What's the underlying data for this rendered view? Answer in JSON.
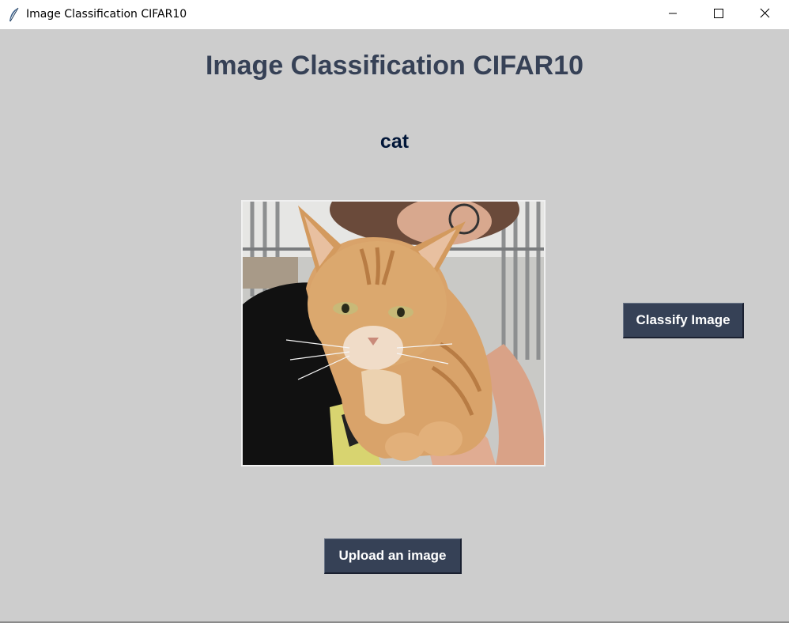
{
  "window": {
    "title": "Image Classification CIFAR10",
    "icon": "feather-icon",
    "controls": [
      "minimize-icon",
      "maximize-icon",
      "close-icon"
    ]
  },
  "main": {
    "heading": "Image Classification CIFAR10",
    "prediction": "cat",
    "image": {
      "subject": "orange tabby cat held by a person"
    }
  },
  "buttons": {
    "classify_label": "Classify Image",
    "upload_label": "Upload an image"
  },
  "colors": {
    "background": "#cdcdcd",
    "heading": "#364156",
    "prediction": "#011638",
    "button_bg": "#364156",
    "button_text": "#ffffff"
  }
}
